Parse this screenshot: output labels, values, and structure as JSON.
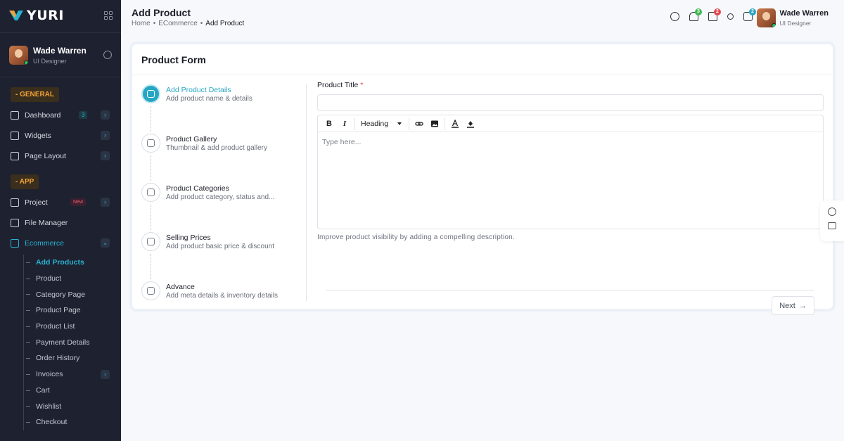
{
  "brand": {
    "name": "YURI"
  },
  "sidebar": {
    "user": {
      "name": "Wade Warren",
      "role": "UI Designer"
    },
    "sections": [
      {
        "label": "- GENERAL"
      },
      {
        "label": "- APP"
      }
    ],
    "general_items": [
      {
        "label": "Dashboard",
        "count": "3"
      },
      {
        "label": "Widgets"
      },
      {
        "label": "Page Layout"
      }
    ],
    "app_items": [
      {
        "label": "Project",
        "badge": "New"
      },
      {
        "label": "File Manager"
      },
      {
        "label": "Ecommerce"
      }
    ],
    "ecommerce_sub": [
      "Add Products",
      "Product",
      "Category Page",
      "Product Page",
      "Product List",
      "Payment Details",
      "Order History",
      "Invoices",
      "Cart",
      "Wishlist",
      "Checkout"
    ]
  },
  "header": {
    "title": "Add Product",
    "breadcrumb": [
      "Home",
      "ECommerce",
      "Add Product"
    ],
    "badges": {
      "bell": "3",
      "bag": "2",
      "cart": "2"
    },
    "user": {
      "name": "Wade Warren",
      "role": "UI Designer"
    }
  },
  "card": {
    "title": "Product Form",
    "steps": [
      {
        "title": "Add Product Details",
        "subtitle": "Add product name & details"
      },
      {
        "title": "Product Gallery",
        "subtitle": "Thumbnail & add product gallery"
      },
      {
        "title": "Product Categories",
        "subtitle": "Add product category, status and..."
      },
      {
        "title": "Selling Prices",
        "subtitle": "Add product basic price & discount"
      },
      {
        "title": "Advance",
        "subtitle": "Add meta details & inventory details"
      }
    ],
    "form": {
      "label": "Product Title",
      "required_mark": "*",
      "title_value": "",
      "toolbar_heading": "Heading",
      "editor_placeholder": "Type here...",
      "hint": "Improve product visibility by adding a compelling description.",
      "next_label": "Next"
    }
  },
  "colors": {
    "accent": "#27a6c4",
    "sidebar_bg": "#1e2130",
    "section_badge": "#f2a33a"
  }
}
